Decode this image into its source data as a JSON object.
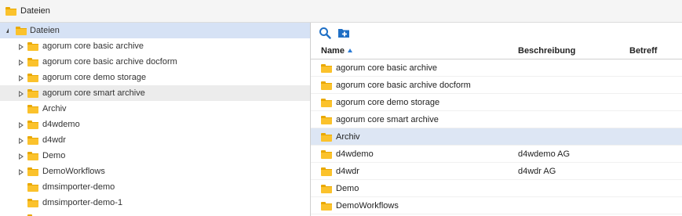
{
  "window": {
    "title": "Dateien"
  },
  "tree": {
    "root_label": "Dateien",
    "items": [
      {
        "label": "agorum core basic archive",
        "has_children": true
      },
      {
        "label": "agorum core basic archive docform",
        "has_children": true
      },
      {
        "label": "agorum core demo storage",
        "has_children": true
      },
      {
        "label": "agorum core smart archive",
        "has_children": true
      },
      {
        "label": "Archiv",
        "has_children": false
      },
      {
        "label": "d4wdemo",
        "has_children": true
      },
      {
        "label": "d4wdr",
        "has_children": true
      },
      {
        "label": "Demo",
        "has_children": true
      },
      {
        "label": "DemoWorkflows",
        "has_children": true
      },
      {
        "label": "dmsimporter-demo",
        "has_children": false
      },
      {
        "label": "dmsimporter-demo-1",
        "has_children": false
      }
    ]
  },
  "toolbar": {
    "search_icon": "search-icon",
    "new_folder_icon": "new-folder-icon"
  },
  "grid": {
    "columns": {
      "name": "Name",
      "description": "Beschreibung",
      "subject": "Betreff"
    },
    "sort": "ascending",
    "rows": [
      {
        "name": "agorum core basic archive",
        "description": ""
      },
      {
        "name": "agorum core basic archive docform",
        "description": ""
      },
      {
        "name": "agorum core demo storage",
        "description": ""
      },
      {
        "name": "agorum core smart archive",
        "description": ""
      },
      {
        "name": "Archiv",
        "description": ""
      },
      {
        "name": "d4wdemo",
        "description": "d4wdemo AG"
      },
      {
        "name": "d4wdr",
        "description": "d4wdr AG"
      },
      {
        "name": "Demo",
        "description": ""
      },
      {
        "name": "DemoWorkflows",
        "description": ""
      }
    ]
  },
  "colors": {
    "folder": "#fbc22c",
    "selection": "#d6e2f5",
    "accent": "#2a7bd6"
  }
}
